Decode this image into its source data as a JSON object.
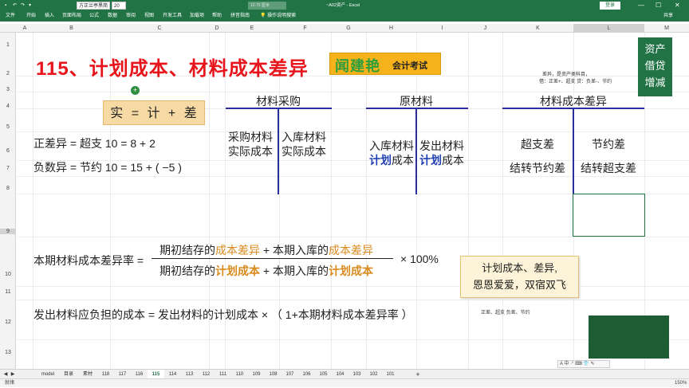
{
  "titlebar": {
    "font_name": "方正兰亭黑简",
    "font_size": "20",
    "search_placeholder": "12.75 厘米",
    "doc_title": "~A02资产 - Excel",
    "signin": "登录",
    "min": "—",
    "max": "☐",
    "close": "✕"
  },
  "menu": [
    "文件",
    "开始",
    "插入",
    "页面布局",
    "公式",
    "数据",
    "审阅",
    "视图",
    "开发工具",
    "加载项",
    "帮助",
    "拼音指南",
    "操作说明搜索"
  ],
  "share": "共享",
  "columns": [
    "A",
    "B",
    "C",
    "D",
    "E",
    "F",
    "G",
    "H",
    "I",
    "J",
    "K",
    "L",
    "M"
  ],
  "rows": [
    "1",
    "2",
    "3",
    "4",
    "5",
    "6",
    "7",
    "8",
    "9",
    "10",
    "11",
    "12",
    "13"
  ],
  "content": {
    "title": "115、计划成本、材料成本差异",
    "logo_main": "闻建艳",
    "logo_sub": "会计考试",
    "formula_box": "实 = 计 + 差",
    "pos_diff": "正差异 = 超支   10 = 8 + 2",
    "neg_diff": "负数异 = 节约   10 = 15 + ( −5 )",
    "t1_title": "材料采购",
    "t1_left": [
      "采购材料",
      "实际成本"
    ],
    "t1_right": [
      "入库材料",
      "实际成本"
    ],
    "t2_title": "原材料",
    "t2_left_a": "入库材料",
    "t2_left_b_blue": "计划",
    "t2_left_b_rest": "成本",
    "t2_right_a": "发出材料",
    "t2_right_b_blue": "计划",
    "t2_right_b_rest": "成本",
    "t3_title": "材料成本差异",
    "t3_left": [
      "超支差",
      "结转节约差"
    ],
    "t3_right": [
      "节约差",
      "结转超支差"
    ],
    "rate_label": "本期材料成本差异率 =",
    "num_a": "期初结存的",
    "num_b": "成本差异",
    "num_c": " + 本期入库的",
    "num_d": "成本差异",
    "den_a": "期初结存的",
    "den_b": "计划成本",
    "den_c": " + 本期入库的",
    "den_d": "计划成本",
    "pct": "× 100%",
    "issue_formula": "发出材料应负担的成本 = 发出材料的计划成本 × （ 1+本期材料成本差异率 ）",
    "memo_line1": "计划成本、差异,",
    "memo_line2": "恩恩爱爱，双宿双飞",
    "side_note1": "差异，是资产类科目，",
    "side_note2": "借：正差+、超支      贷：负差-、节约",
    "small_note": "正差、超支            负差、节约",
    "asset_box": [
      "资产",
      "借贷",
      "增减"
    ]
  },
  "tabs": [
    "model",
    "目录",
    "素材",
    "118",
    "117",
    "116",
    "115",
    "114",
    "113",
    "112",
    "111",
    "110",
    "109",
    "108",
    "107",
    "106",
    "105",
    "104",
    "103",
    "102",
    "101"
  ],
  "active_tab": "115",
  "add_sheet": "+",
  "status": "就绪",
  "zoom": "150%",
  "minitool": "A 中 ·° ⌨ 👕 ✎"
}
